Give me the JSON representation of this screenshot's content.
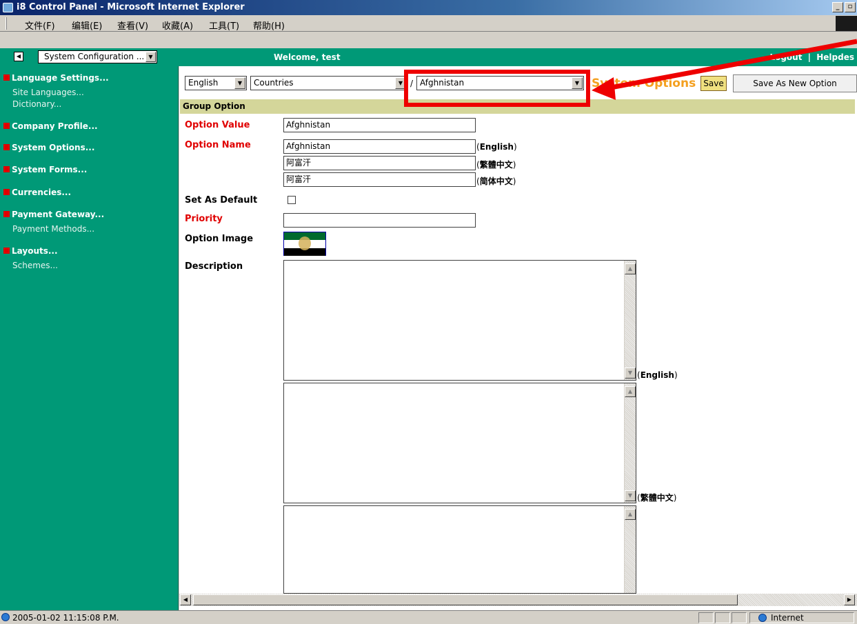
{
  "window": {
    "title": "i8 Control Panel - Microsoft Internet Explorer",
    "min_glyph": "_",
    "max_glyph": "▫"
  },
  "menu": [
    "文件(F)",
    "编辑(E)",
    "查看(V)",
    "收藏(A)",
    "工具(T)",
    "帮助(H)"
  ],
  "header": {
    "nav_toggle": "◀",
    "module_select": "System Configuration ...",
    "welcome": "Welcome, test",
    "logout": "Logout",
    "separator": "|",
    "helpdesk": "Helpdes"
  },
  "sidebar": {
    "sections": [
      {
        "label": "Language Settings...",
        "links": [
          "Site Languages...",
          "Dictionary..."
        ]
      },
      {
        "label": "Company Profile...",
        "links": []
      },
      {
        "label": "System Options...",
        "links": []
      },
      {
        "label": "System Forms...",
        "links": []
      },
      {
        "label": "Currencies...",
        "links": []
      },
      {
        "label": "Payment Gateway...",
        "links": [
          "Payment Methods..."
        ]
      },
      {
        "label": "Layouts...",
        "links": [
          "Schemes..."
        ]
      }
    ]
  },
  "toolbar": {
    "language_select": "English",
    "group_select": "Countries",
    "path_sep": "/",
    "option_select": "Afghnistan",
    "page_title": "System Options",
    "save_label": "Save",
    "save_as_label": "Save As New Option"
  },
  "form": {
    "group_title": "Group Option",
    "option_value_label": "Option Value",
    "option_value": "Afghnistan",
    "option_name_label": "Option Name",
    "names": [
      {
        "value": "Afghnistan",
        "lang": "English"
      },
      {
        "value": "阿富汗",
        "lang": "繁體中文"
      },
      {
        "value": "阿富汗",
        "lang": "简体中文"
      }
    ],
    "default_label": "Set As Default",
    "priority_label": "Priority",
    "priority_value": "",
    "image_label": "Option Image",
    "description_label": "Description",
    "desc_langs": [
      "English",
      "繁體中文"
    ]
  },
  "status": {
    "text": "2005-01-02 11:15:08 P.M.",
    "zone": "Internet"
  },
  "colors": {
    "sidebar_bg": "#009977",
    "accent_red": "#e00000",
    "title_orange": "#f4a020",
    "group_bar": "#d4d69a"
  }
}
